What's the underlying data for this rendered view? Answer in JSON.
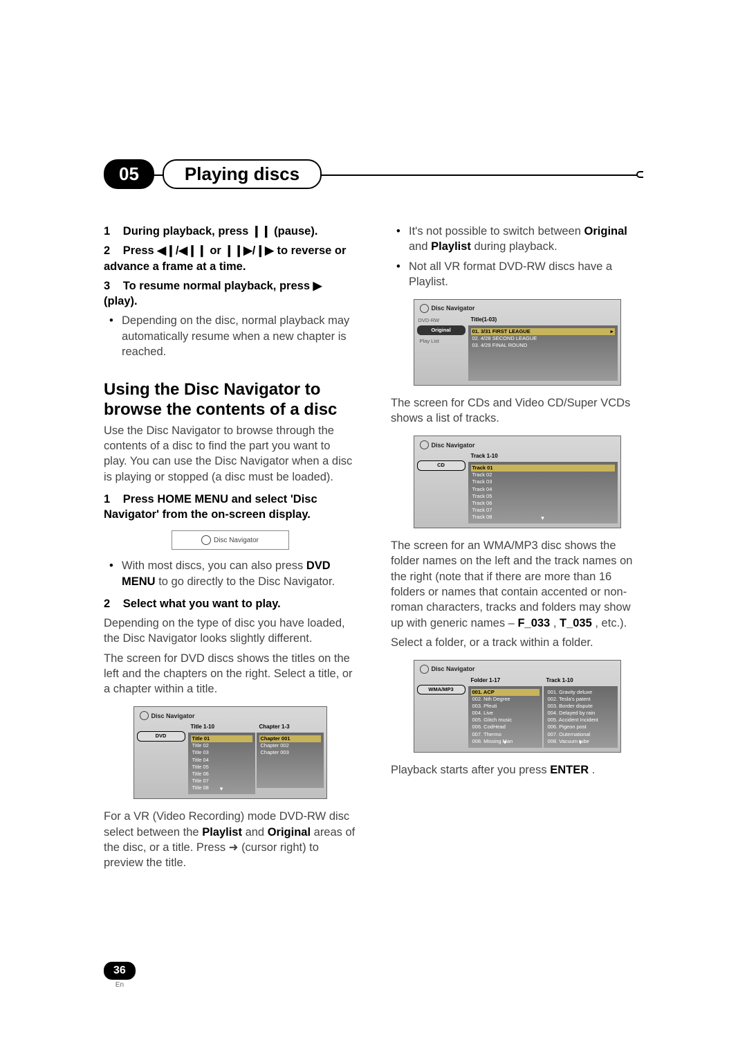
{
  "chapter": {
    "num": "05",
    "title": "Playing discs"
  },
  "pageNumber": "36",
  "lang": "En",
  "left": {
    "step1": {
      "n": "1",
      "t": "During playback, press ❙❙ (pause)."
    },
    "step2": {
      "n": "2",
      "t": "Press ◀❙/◀❙❙ or ❙❙▶/❙▶ to reverse or advance a frame at a time."
    },
    "step3": {
      "n": "3",
      "t": "To resume normal playback, press ▶ (play)."
    },
    "step3bullet": "Depending on the disc, normal playback may automatically resume when a new chapter is reached.",
    "heading": "Using the Disc Navigator to browse the contents of a disc",
    "intro": "Use the Disc Navigator to browse through the contents of a disc to find the part you want to play. You can use the Disc Navigator when a disc is playing or stopped (a disc must be loaded).",
    "s1": {
      "n": "1",
      "t": "Press HOME MENU and select 'Disc Navigator' from the on-screen display."
    },
    "navBtn": "Disc Navigator",
    "s1bulletPre": "With most discs, you can also press ",
    "s1bulletBold": "DVD MENU",
    "s1bulletPost": " to go directly to the Disc Navigator.",
    "s2": {
      "n": "2",
      "t": "Select what you want to play."
    },
    "s2p1": "Depending on the type of disc you have loaded, the Disc Navigator looks slightly different.",
    "s2p2": "The screen for DVD discs shows the titles on the left and the chapters on the right. Select a title, or a chapter within a title.",
    "ss_dvd": {
      "title": "Disc Navigator",
      "leftTag": "DVD",
      "col1h": "Title 1-10",
      "col2h": "Chapter 1-3",
      "col1": [
        "Title 01",
        "Title 02",
        "Title 03",
        "Title 04",
        "Title 05",
        "Title 06",
        "Title 07",
        "Title 08"
      ],
      "col2": [
        "Chapter 001",
        "Chapter 002",
        "Chapter 003"
      ]
    },
    "vrNote1": "For a VR (Video Recording) mode DVD-RW disc select between the ",
    "vrB1": "Playlist",
    "vrMid": " and ",
    "vrB2": "Original",
    "vrNote2": " areas of the disc, or a title. Press ➜ (cursor right) to preview the title."
  },
  "right": {
    "b1pre": "It's not possible to switch between ",
    "b1b1": "Original",
    "b1mid": " and ",
    "b1b2": "Playlist",
    "b1post": " during playback.",
    "b2": "Not all VR format DVD-RW discs have a Playlist.",
    "ss_dvdrw": {
      "title": "Disc Navigator",
      "leftItems": [
        "DVD-RW",
        "Original",
        "Play List"
      ],
      "h": "Title(1-03)",
      "rows": [
        "01. 3/31 FIRST LEAGUE",
        "02. 4/28 SECOND LEAGUE",
        "03. 4/29 FINAL ROUND"
      ]
    },
    "cdIntro": "The screen for CDs and Video CD/Super VCDs shows a list of tracks.",
    "ss_cd": {
      "title": "Disc Navigator",
      "leftTag": "CD",
      "h": "Track 1-10",
      "rows": [
        "Track 01",
        "Track 02",
        "Track 03",
        "Track 04",
        "Track 05",
        "Track 06",
        "Track 07",
        "Track 08"
      ]
    },
    "mp3p1pre": "The screen for an WMA/MP3 disc shows the folder names on the left and the track names on the right (note that if there are more than 16 folders or names that contain accented or non-roman characters, tracks and folders may show up with generic names – ",
    "mp3b1": "F_033",
    "mp3mid": ", ",
    "mp3b2": "T_035",
    "mp3post": ", etc.).",
    "mp3p2": "Select a folder, or a track within a folder.",
    "ss_mp3": {
      "title": "Disc Navigator",
      "leftTag": "WMA/MP3",
      "col1h": "Folder 1-17",
      "col2h": "Track 1-10",
      "col1": [
        "001. ACP",
        "002. Nth Degree",
        "003. Pfeuti",
        "004. Live",
        "005. Glitch music",
        "006. CodHead",
        "007. Thermo",
        "008. Missing Man"
      ],
      "col2": [
        "001. Gravity deluxe",
        "002. Tesla's patent",
        "003. Border dispute",
        "004. Delayed by rain",
        "005. Accident Incident",
        "006. Pigeon post",
        "007. Outernational",
        "008. Vacuum tube"
      ]
    },
    "enterPre": "Playback starts after you press ",
    "enterB": "ENTER",
    "enterPost": "."
  }
}
